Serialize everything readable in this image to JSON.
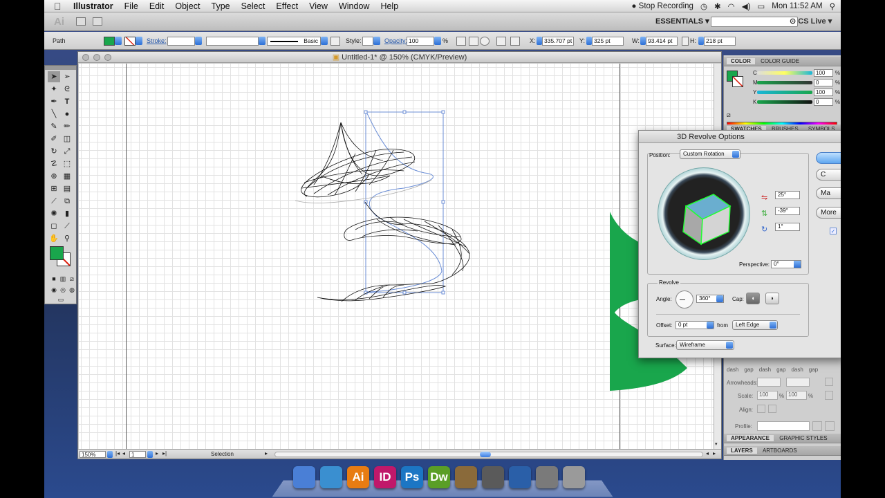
{
  "menubar": {
    "app": "Illustrator",
    "items": [
      "File",
      "Edit",
      "Object",
      "Type",
      "Select",
      "Effect",
      "View",
      "Window",
      "Help"
    ],
    "status_recording": "Stop Recording",
    "clock": "Mon 11:52 AM"
  },
  "appbar": {
    "logo": "Ai",
    "workspace": "ESSENTIALS",
    "cslive": "CS Live"
  },
  "control": {
    "object_type": "Path",
    "stroke_label": "Stroke:",
    "brush": "Basic",
    "style_label": "Style:",
    "opacity_label": "Opacity:",
    "opacity_value": "100",
    "opacity_unit": "%",
    "x_label": "X:",
    "x_value": "335.707 pt",
    "y_label": "Y:",
    "y_value": "325 pt",
    "w_label": "W:",
    "w_value": "93.414 pt",
    "h_label": "H:",
    "h_value": "218 pt"
  },
  "document": {
    "title": "Untitled-1* @ 150% (CMYK/Preview)",
    "zoom": "150%",
    "artboard": "1",
    "tool_status": "Selection"
  },
  "colors": {
    "fill": "#19a64c",
    "accent": "#2d6fd6"
  },
  "color_panel": {
    "tabs": [
      "COLOR",
      "COLOR GUIDE"
    ],
    "channels": [
      {
        "label": "C",
        "value": "100",
        "unit": "%",
        "color": "#19b6d8"
      },
      {
        "label": "M",
        "value": "0",
        "unit": "%",
        "color": "#333333"
      },
      {
        "label": "Y",
        "value": "100",
        "unit": "%",
        "color": "#d8cc1a"
      },
      {
        "label": "K",
        "value": "0",
        "unit": "%",
        "color": "#222222"
      }
    ]
  },
  "swatch_tabs": [
    "SWATCHES",
    "BRUSHES",
    "SYMBOLS"
  ],
  "stroke_panel": {
    "dash_labels": [
      "dash",
      "gap",
      "dash",
      "gap",
      "dash",
      "gap"
    ],
    "arrowheads": "Arrowheads:",
    "scale": "Scale:",
    "scale_values": [
      "100",
      "%",
      "100",
      "%"
    ],
    "align": "Align:",
    "profile": "Profile:"
  },
  "bottom_tabs": {
    "appearance": "APPEARANCE",
    "graphic_styles": "GRAPHIC STYLES",
    "layers": "LAYERS",
    "artboards": "ARTBOARDS"
  },
  "dialog": {
    "title": "3D Revolve Options",
    "position_label": "Position:",
    "position_value": "Custom Rotation",
    "rot_x": "25°",
    "rot_y": "-39°",
    "rot_z": "1°",
    "perspective_label": "Perspective:",
    "perspective_value": "0°",
    "revolve_label": "Revolve",
    "angle_label": "Angle:",
    "angle_value": "360°",
    "cap_label": "Cap:",
    "offset_label": "Offset:",
    "offset_value": "0 pt",
    "from_label": "from",
    "from_value": "Left Edge",
    "surface_label": "Surface:",
    "surface_value": "Wireframe",
    "buttons": [
      "",
      "C",
      "Ma",
      "More"
    ]
  },
  "dock": [
    {
      "name": "finder",
      "label": "",
      "color": "#4a7fd6"
    },
    {
      "name": "safari",
      "label": "",
      "color": "#3a8fd0"
    },
    {
      "name": "illustrator",
      "label": "Ai",
      "color": "#e87c12"
    },
    {
      "name": "indesign",
      "label": "ID",
      "color": "#c0186a"
    },
    {
      "name": "photoshop",
      "label": "Ps",
      "color": "#1c76c4"
    },
    {
      "name": "dreamweaver",
      "label": "Dw",
      "color": "#5a9e26"
    },
    {
      "name": "iphoto",
      "label": "",
      "color": "#8a6a3a"
    },
    {
      "name": "imovie",
      "label": "",
      "color": "#5a5a5a"
    },
    {
      "name": "quicktime",
      "label": "",
      "color": "#2a5fa8"
    },
    {
      "name": "system-preferences",
      "label": "",
      "color": "#7a7a7a"
    },
    {
      "name": "trash",
      "label": "",
      "color": "#9a9a9a"
    }
  ]
}
